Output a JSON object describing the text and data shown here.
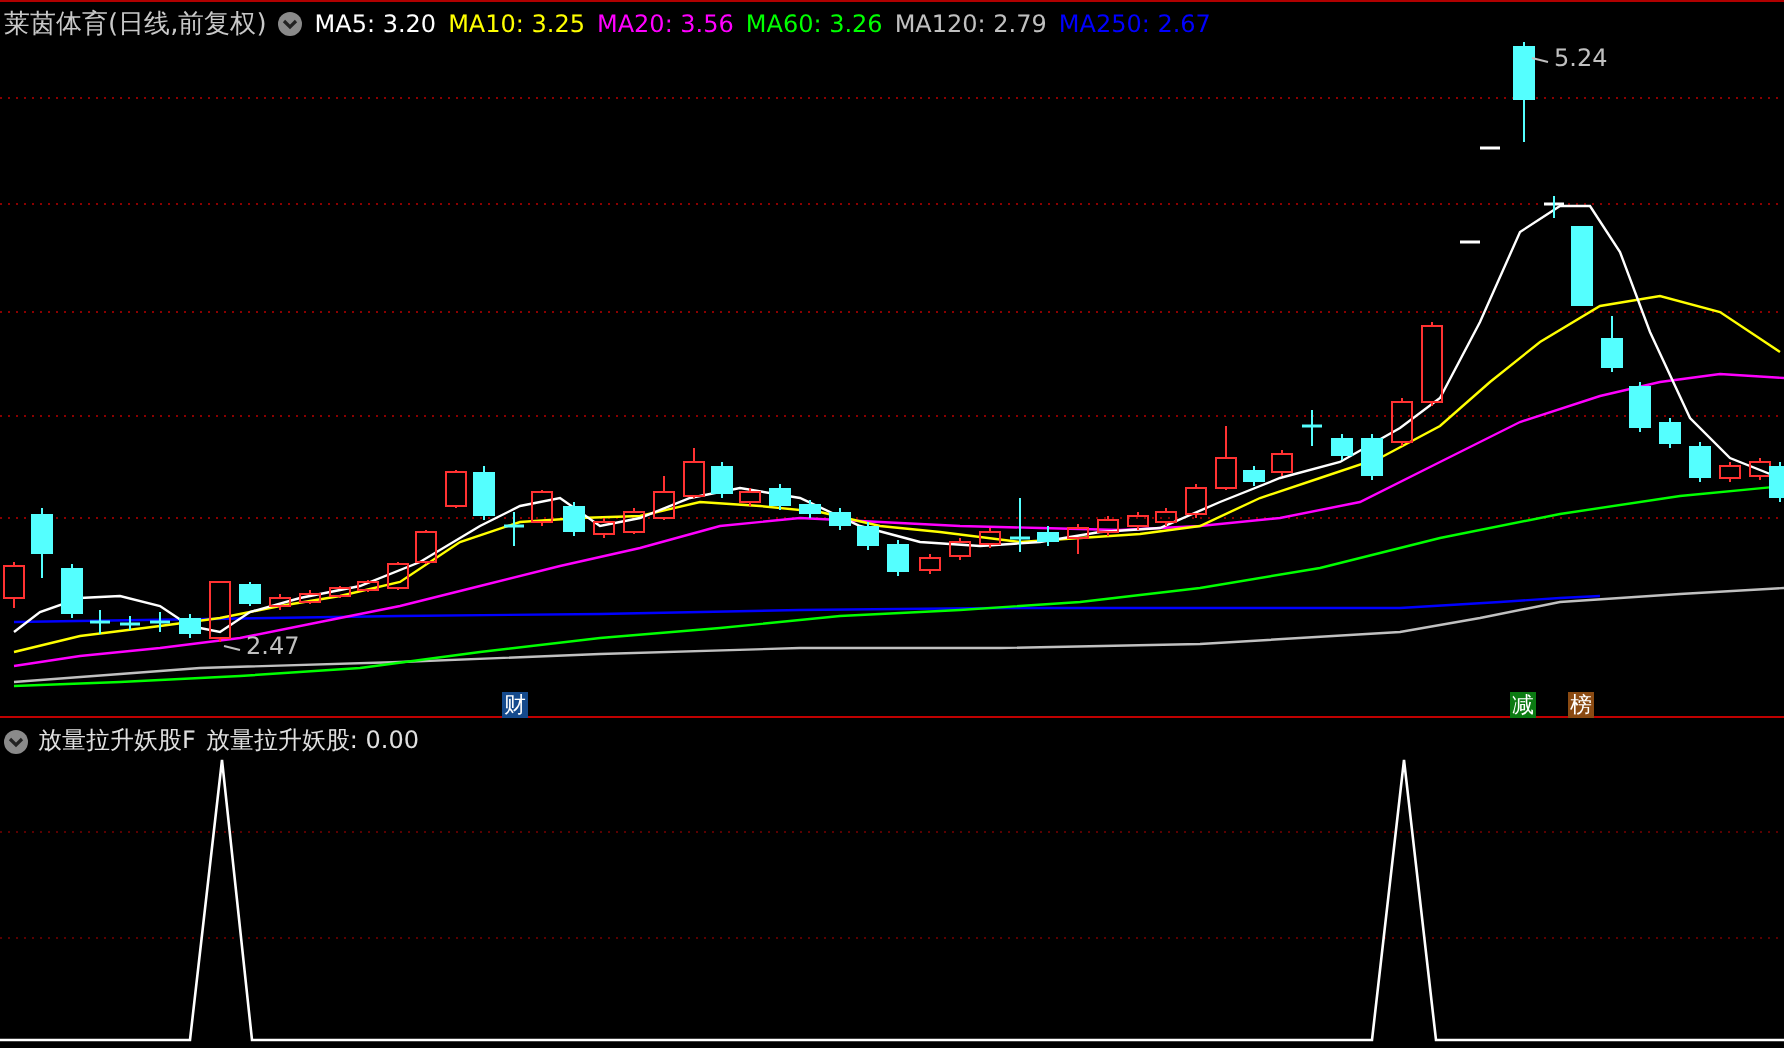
{
  "header": {
    "title": "莱茵体育(日线,前复权)",
    "indicators": [
      {
        "label": "MA5: 3.20",
        "color": "#ffffff"
      },
      {
        "label": "MA10: 3.25",
        "color": "#ffff00"
      },
      {
        "label": "MA20: 3.56",
        "color": "#ff00ff"
      },
      {
        "label": "MA60: 3.26",
        "color": "#00ff00"
      },
      {
        "label": "MA120: 2.79",
        "color": "#c0c0c0"
      },
      {
        "label": "MA250: 2.67",
        "color": "#0000ff"
      }
    ]
  },
  "price_labels": {
    "high": "5.24",
    "low": "2.47"
  },
  "event_markers": [
    {
      "label": "财",
      "color": "#154a8c"
    },
    {
      "label": "减",
      "color": "#0b7a12"
    },
    {
      "label": "榜",
      "color": "#8a4a12"
    }
  ],
  "indicator_panel": {
    "name": "放量拉升妖股F",
    "reading": "放量拉升妖股: 0.00"
  }
}
